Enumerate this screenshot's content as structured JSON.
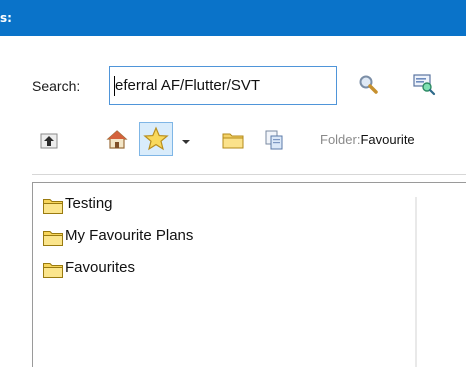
{
  "window": {
    "title": "s:"
  },
  "search": {
    "label": "Search:",
    "value": "eferral AF/Flutter/SVT"
  },
  "toolbar": {
    "folder_label": "Folder:",
    "folder_value": "Favourite"
  },
  "tree": {
    "items": [
      {
        "label": "Testing",
        "icon": "folder-icon"
      },
      {
        "label": "My Favourite Plans",
        "icon": "folder-icon"
      },
      {
        "label": "Favourites",
        "icon": "folder-icon"
      }
    ]
  },
  "colors": {
    "title_bar": "#0a73c9",
    "input_border": "#4f95d9",
    "folder_yellow": "#f7d55b"
  }
}
